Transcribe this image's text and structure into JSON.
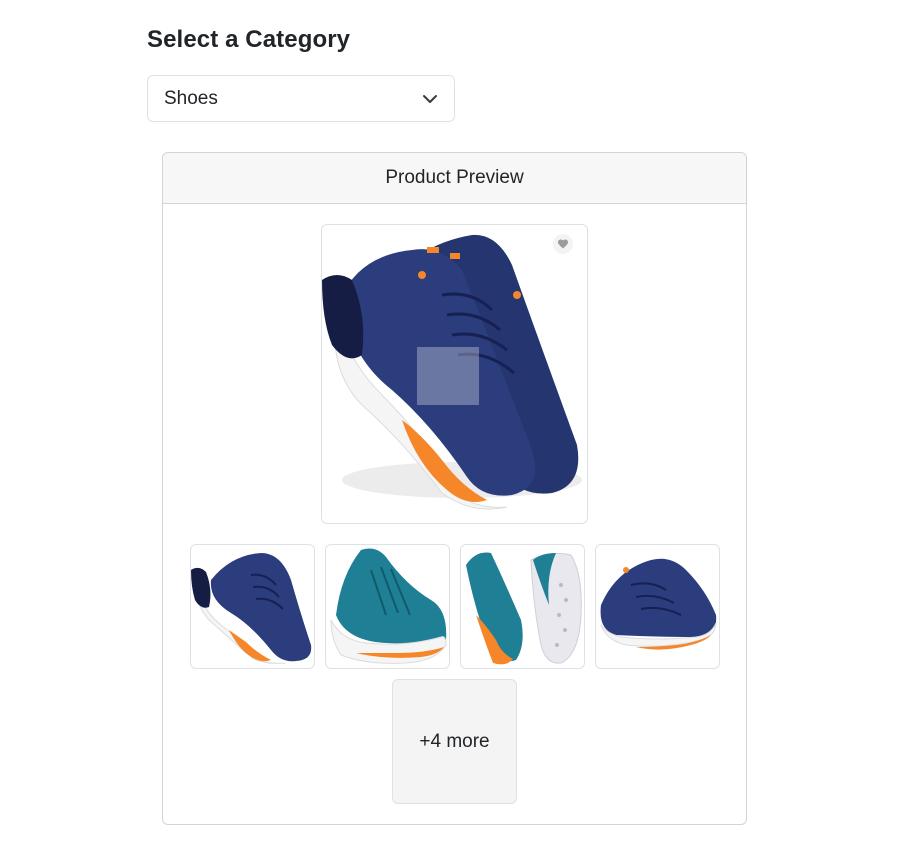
{
  "heading": "Select a Category",
  "category_select": {
    "value": "Shoes",
    "icon": "chevron-down-icon"
  },
  "preview": {
    "title": "Product Preview",
    "main_image": {
      "alt": "Navy and orange running shoes",
      "favorite_icon": "heart-icon"
    },
    "thumbnails": [
      {
        "alt": "Navy and orange running shoes"
      },
      {
        "alt": "Teal running shoe"
      },
      {
        "alt": "Teal running shoe pair, side and sole view"
      },
      {
        "alt": "Navy and orange running shoes, side view"
      }
    ],
    "more_label": "+4 more"
  },
  "colors": {
    "navy": "#1f2f66",
    "orange": "#f5862a",
    "teal": "#1f7f95",
    "border": "#dee2e6",
    "header_bg": "#f7f7f7"
  }
}
